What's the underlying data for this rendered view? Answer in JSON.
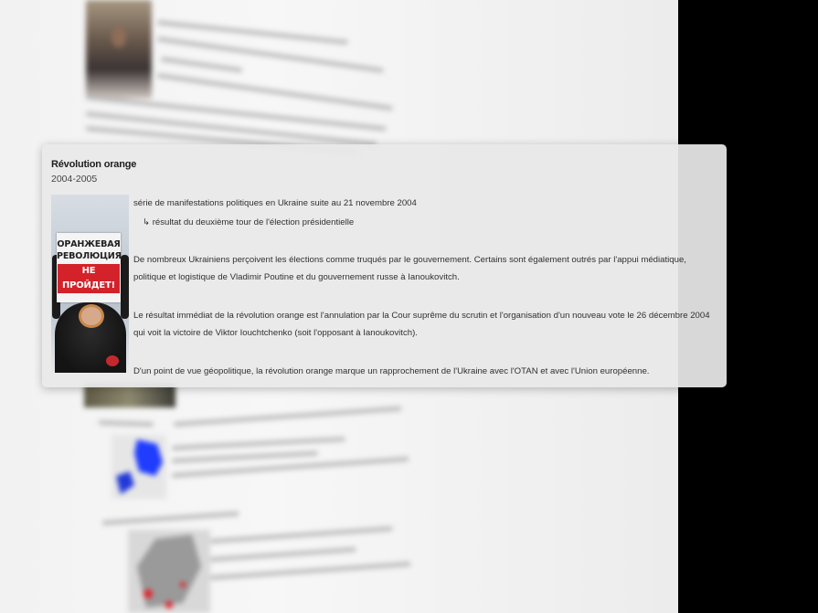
{
  "card": {
    "title": "Révolution orange",
    "dates": "2004-2005",
    "summary": "série de manifestations politiques en Ukraine suite au 21 novembre 2004",
    "sub_note": "↳ résultat du deuxième tour de l'élection présidentielle",
    "paragraphs": [
      "De nombreux Ukrainiens perçoivent les élections comme truqués par le gouvernement. Certains sont également outrés par l'appui médiatique, politique et logistique de Vladimir Poutine et du gouvernement russe à Ianoukovitch.",
      "Le résultat immédiat de la révolution orange est l'annulation par la Cour suprême du scrutin et l'organisation d'un nouveau vote le 26 décembre 2004 qui voit la victoire de Viktor Iouchtchenko (soit l'opposant à Ianoukovitch).",
      "D'un point de vue géopolitique, la révolution orange marque un rapprochement de l'Ukraine avec l'OTAN et avec l'Union européenne."
    ],
    "photo_sign": {
      "line1": "ОРАНЖЕВАЯ",
      "line2": "РЕВОЛЮЦИЯ",
      "line3": "НЕ ПРОЙДЕТ!"
    }
  },
  "colors": {
    "backdrop": "#000000",
    "page": "#f2f2f2",
    "card": "#e8e8e8",
    "sign_red": "#d3222a",
    "map_blue": "#1f3cff"
  }
}
